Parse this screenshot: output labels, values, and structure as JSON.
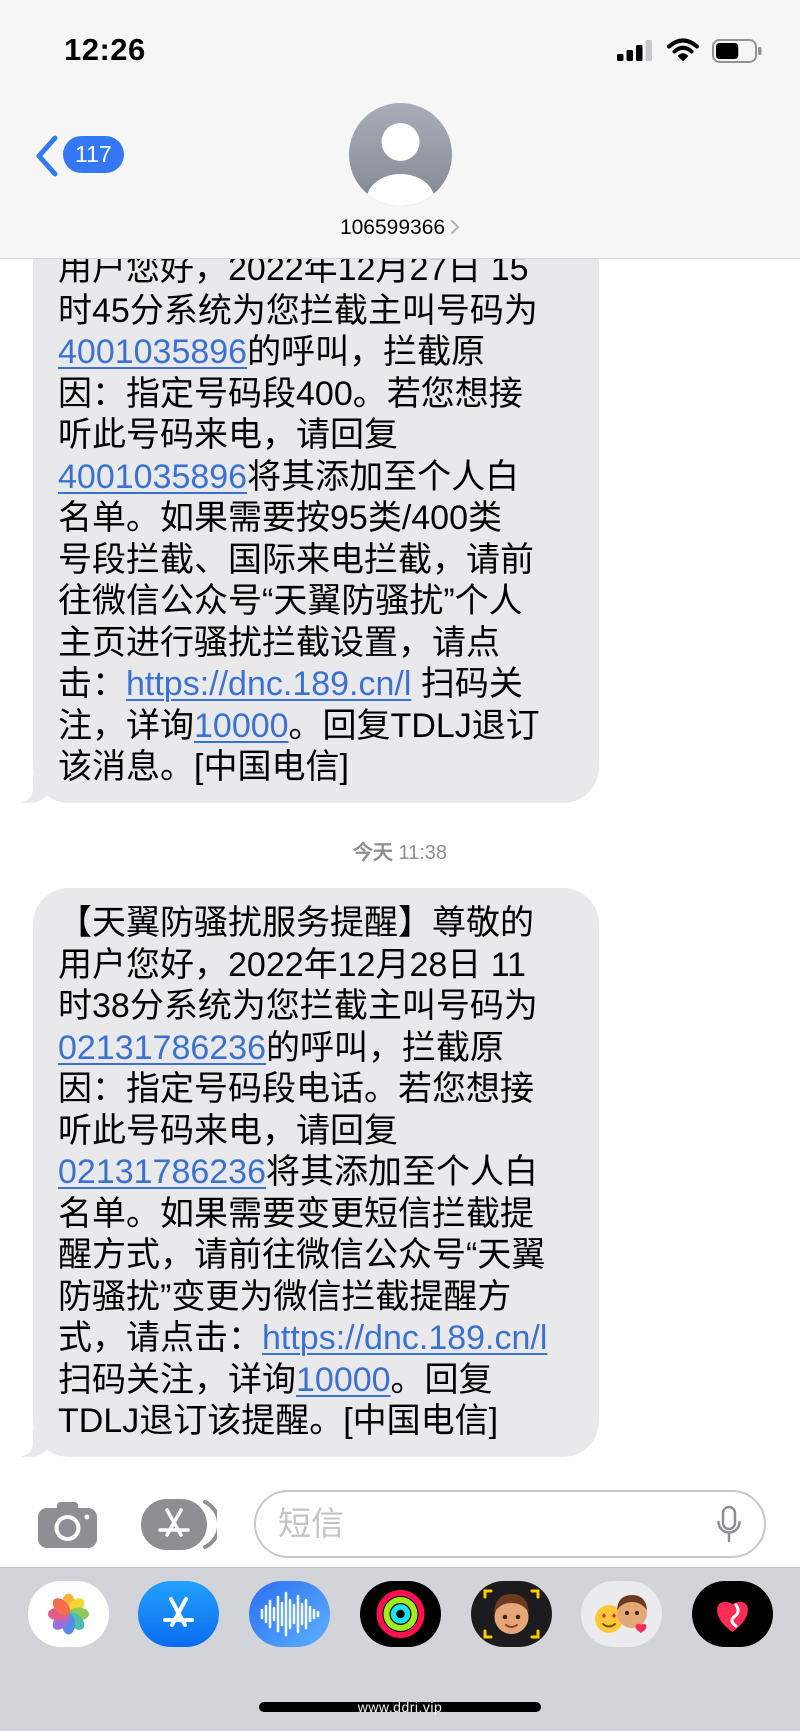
{
  "status_bar": {
    "time": "12:26",
    "signal_bars": 3,
    "battery_level": 0.6
  },
  "header": {
    "back_badge": "117",
    "contact_name": "106599366"
  },
  "conversation": {
    "messages": [
      {
        "lines": [
          [
            {
              "text": "用户您好，2022年12月27日 15"
            }
          ],
          [
            {
              "text": "时45分系统为您拦截主叫号码为"
            }
          ],
          [
            {
              "text": "4001035896",
              "link": true
            },
            {
              "text": "的呼叫，拦截原"
            }
          ],
          [
            {
              "text": "因：指定号码段400。若您想接"
            }
          ],
          [
            {
              "text": "听此号码来电，请回复"
            }
          ],
          [
            {
              "text": "4001035896",
              "link": true
            },
            {
              "text": "将其添加至个人白"
            }
          ],
          [
            {
              "text": "名单。如果需要按95类/400类"
            }
          ],
          [
            {
              "text": "号段拦截、国际来电拦截，请前"
            }
          ],
          [
            {
              "text": "往微信公众号“天翼防骚扰”个人"
            }
          ],
          [
            {
              "text": "主页进行骚扰拦截设置，请点"
            }
          ],
          [
            {
              "text": "击："
            },
            {
              "text": "https://dnc.189.cn/l",
              "link": true
            },
            {
              "text": " 扫码关"
            }
          ],
          [
            {
              "text": "注，详询"
            },
            {
              "text": "10000",
              "link": true
            },
            {
              "text": "。回复TDLJ退订"
            }
          ],
          [
            {
              "text": "该消息。[中国电信]"
            }
          ]
        ]
      },
      {
        "lines": [
          [
            {
              "text": "【天翼防骚扰服务提醒】尊敬的"
            }
          ],
          [
            {
              "text": "用户您好，2022年12月28日 11"
            }
          ],
          [
            {
              "text": "时38分系统为您拦截主叫号码为"
            }
          ],
          [
            {
              "text": "02131786236",
              "link": true
            },
            {
              "text": "的呼叫，拦截原"
            }
          ],
          [
            {
              "text": "因：指定号码段电话。若您想接"
            }
          ],
          [
            {
              "text": "听此号码来电，请回复"
            }
          ],
          [
            {
              "text": "02131786236",
              "link": true
            },
            {
              "text": "将其添加至个人白"
            }
          ],
          [
            {
              "text": "名单。如果需要变更短信拦截提"
            }
          ],
          [
            {
              "text": "醒方式，请前往微信公众号“天翼"
            }
          ],
          [
            {
              "text": "防骚扰”变更为微信拦截提醒方"
            }
          ],
          [
            {
              "text": "式，请点击："
            },
            {
              "text": "https://dnc.189.cn/l",
              "link": true
            }
          ],
          [
            {
              "text": "扫码关注，详询"
            },
            {
              "text": "10000",
              "link": true
            },
            {
              "text": "。回复"
            }
          ],
          [
            {
              "text": "TDLJ退订该提醒。[中国电信]"
            }
          ]
        ]
      }
    ],
    "timestamp": {
      "day": "今天",
      "time": "11:38"
    }
  },
  "composer": {
    "placeholder": "短信",
    "icons": [
      "camera-icon",
      "app-store-icon",
      "microphone-icon"
    ]
  },
  "app_drawer": {
    "icons": [
      "photos-icon",
      "app-store-icon",
      "audio-message-icon",
      "activity-icon",
      "memoji-icon",
      "memoji-stickers-icon",
      "digital-touch-icon"
    ]
  },
  "watermark": "www.ddri.vip",
  "colors": {
    "accent": "#3478f6",
    "bubble": "#e9e9eb",
    "link": "#3b72cf",
    "header_bg": "#f6f6f6",
    "drawer_bg": "#d3d4d9",
    "secondary_text": "#8e8e93"
  }
}
